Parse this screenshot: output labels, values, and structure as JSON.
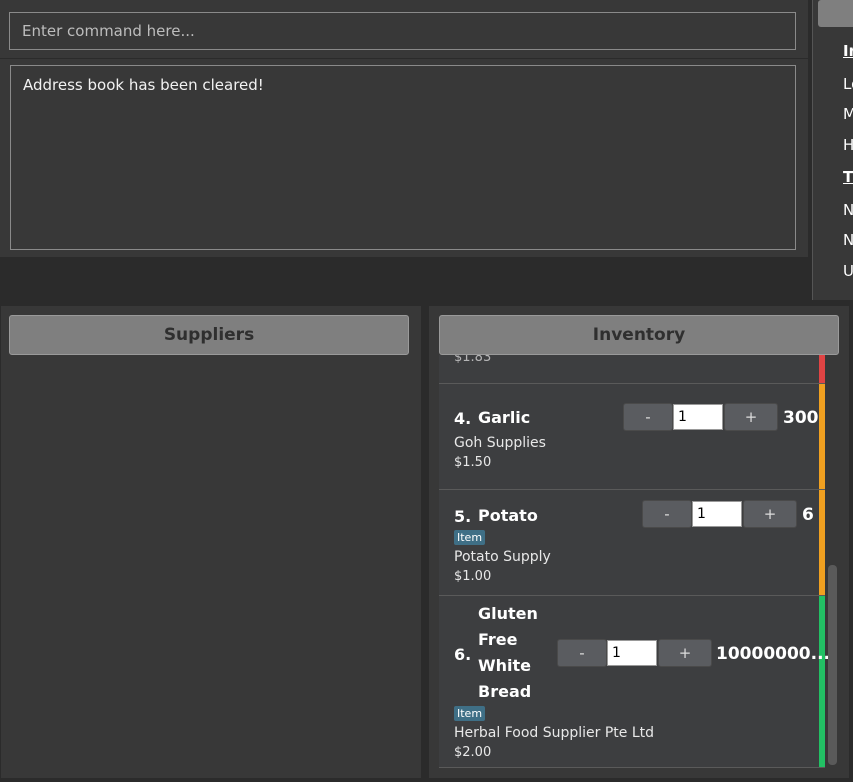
{
  "command": {
    "placeholder": "Enter command here..."
  },
  "result": {
    "text": "Address book has been cleared!"
  },
  "side_panel": {
    "items": [
      "In",
      "Lo",
      "M",
      "H",
      "T",
      "N",
      "N",
      "U"
    ]
  },
  "suppliers": {
    "title": "Suppliers"
  },
  "inventory": {
    "title": "Inventory",
    "partial_price": "$1.83",
    "items": [
      {
        "index": "4.",
        "name": "Garlic",
        "supplier": "Goh Supplies",
        "price": "$1.50",
        "qty": "1",
        "stock": "300",
        "minus": "-",
        "plus": "+"
      },
      {
        "index": "5.",
        "name": "Potato",
        "tag": "Item",
        "supplier": "Potato Supply",
        "price": "$1.00",
        "qty": "1",
        "stock": "6",
        "minus": "-",
        "plus": "+"
      },
      {
        "index": "6.",
        "name_lines": [
          "Gluten",
          "Free",
          "White",
          "Bread"
        ],
        "tag": "Item",
        "supplier": "Herbal Food Supplier Pte Ltd",
        "price": "$2.00",
        "qty": "1",
        "stock": "10000000...",
        "minus": "-",
        "plus": "+"
      }
    ]
  },
  "colors": {
    "red": "#e04444",
    "orange": "#f0a020",
    "green": "#22c064"
  }
}
